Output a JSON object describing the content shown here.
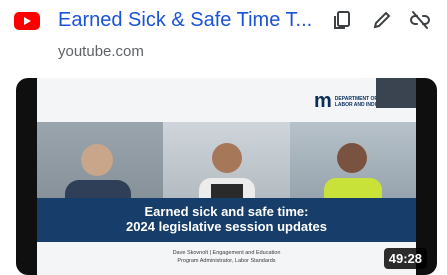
{
  "result": {
    "title": "Earned Sick & Safe Time T...",
    "source": "youtube.com",
    "icons": {
      "site": "youtube-icon",
      "copy": "copy-icon",
      "edit": "pencil-icon",
      "unlink": "unlink-icon"
    }
  },
  "thumbnail": {
    "duration": "49:28",
    "slide": {
      "logo_mark": "m",
      "department_line1": "DEPARTMENT OF",
      "department_line2": "LABOR AND INDUSTRY",
      "title_line1": "Earned sick and safe time:",
      "title_line2": "2024 legislative session updates",
      "presenter_line1": "Dave Skovnolt | Engagement and Education",
      "presenter_line2": "Program Administrator, Labor Standards"
    }
  },
  "colors": {
    "link": "#1a52d8",
    "youtube_red": "#ff0000",
    "banner": "#173d6a"
  }
}
